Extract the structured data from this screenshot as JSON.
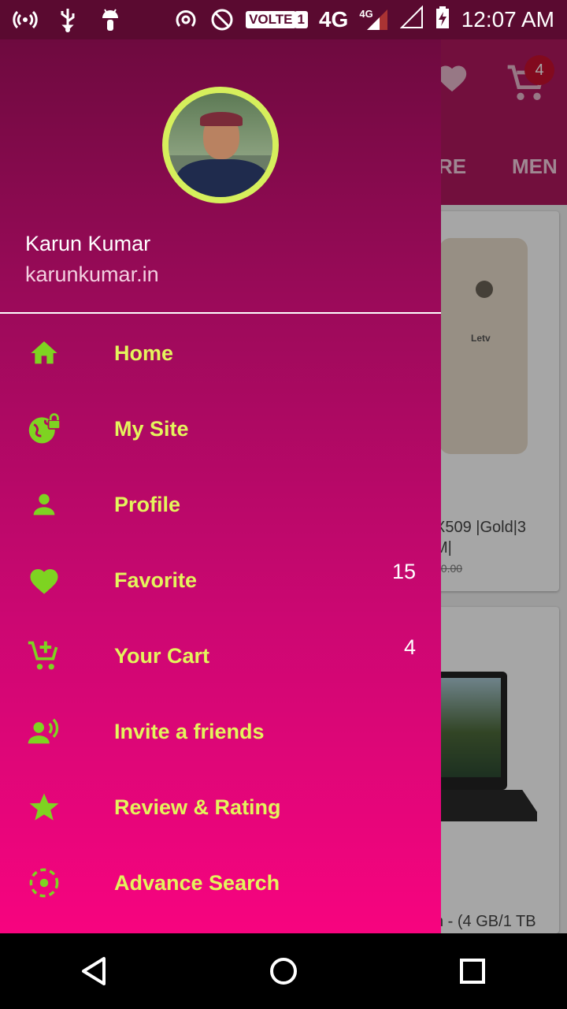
{
  "status_bar": {
    "icons": [
      "hotspot-icon",
      "usb-icon",
      "android-debug-icon",
      "wifi-calling-icon",
      "do-not-disturb-icon"
    ],
    "volte": "VOLTE",
    "sim": "1",
    "network": "4G",
    "network_small": "4G",
    "clock": "12:07 AM"
  },
  "background_app": {
    "cart_count": "4",
    "tabs": [
      "RE",
      "MEN"
    ],
    "card1": {
      "brand": "Letv",
      "title_line1": "X509 |Gold|3",
      "title_line2": "M|",
      "price_struck": "00.00"
    },
    "card2": {
      "title_line": "n - (4 GB/1 TB"
    }
  },
  "drawer": {
    "user_name": "Karun Kumar",
    "user_site": "karunkumar.in",
    "menu": [
      {
        "label": "Home",
        "icon": "home-icon",
        "count": ""
      },
      {
        "label": "My Site",
        "icon": "globe-lock-icon",
        "count": ""
      },
      {
        "label": "Profile",
        "icon": "person-icon",
        "count": ""
      },
      {
        "label": "Favorite",
        "icon": "heart-icon",
        "count": "15"
      },
      {
        "label": "Your Cart",
        "icon": "cart-add-icon",
        "count": "4"
      },
      {
        "label": "Invite a friends",
        "icon": "person-voice-icon",
        "count": ""
      },
      {
        "label": "Review & Rating",
        "icon": "star-icon",
        "count": ""
      },
      {
        "label": "Advance Search",
        "icon": "target-icon",
        "count": ""
      }
    ]
  },
  "colors": {
    "icon_green": "#7ed321",
    "label_yellow": "#e4f45c",
    "avatar_ring": "#d6ef5c",
    "drawer_top": "#6e0a3f",
    "drawer_bottom": "#f7047f"
  },
  "nav_bar": [
    "back-icon",
    "home-circle-icon",
    "recents-icon"
  ]
}
